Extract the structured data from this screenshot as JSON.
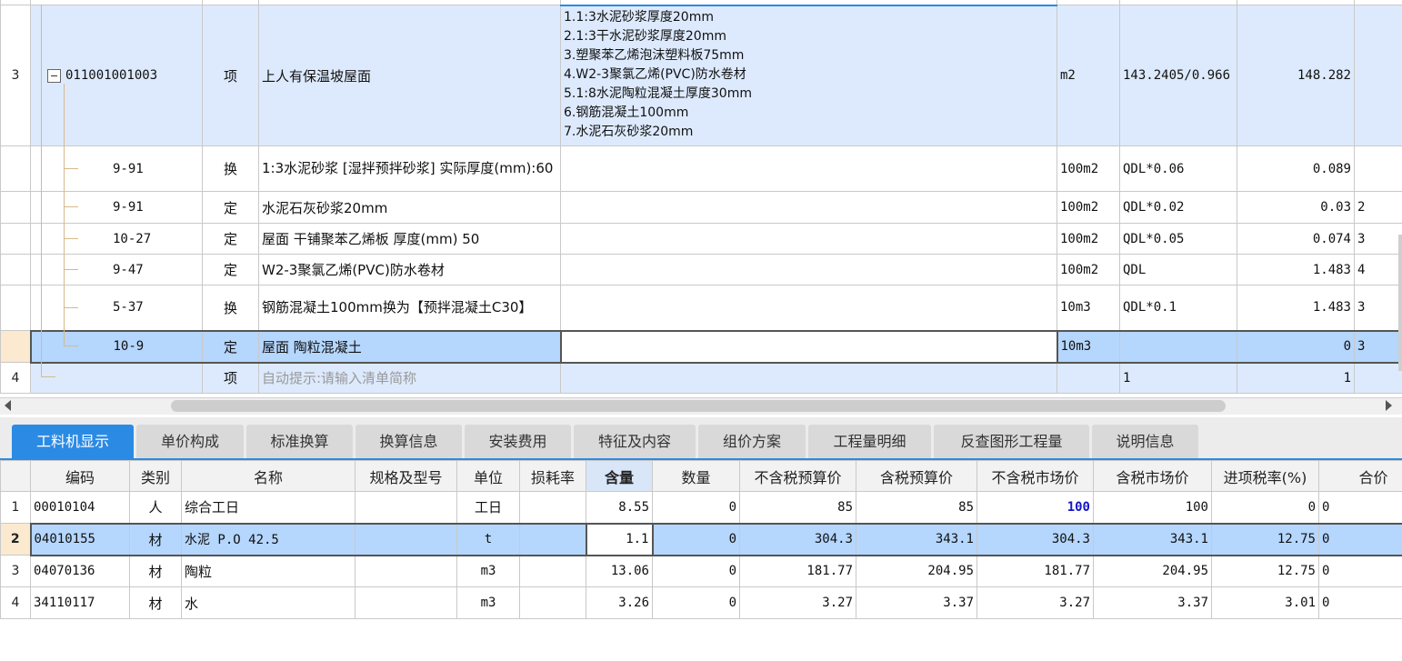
{
  "upper": {
    "rows": [
      {
        "num": "3",
        "code": "011001001003",
        "type": "项",
        "name": "上人有保温坡屋面",
        "desc": [
          "1.1:3水泥砂浆厚度20mm",
          "2.1:3干水泥砂浆厚度20mm",
          "3.塑聚苯乙烯泡沫塑料板75mm",
          "4.W2-3聚氯乙烯(PVC)防水卷材",
          "5.1:8水泥陶粒混凝土厚度30mm",
          "6.钢筋混凝土100mm",
          "7.水泥石灰砂浆20mm"
        ],
        "unit": "m2",
        "expr": "143.2405/0.966",
        "qty": "148.282"
      },
      {
        "num": "",
        "code": "9-91",
        "type": "换",
        "name": "1:3水泥砂浆 [湿拌预拌砂浆] 实际厚度(mm):60",
        "unit": "100m2",
        "expr": "QDL*0.06",
        "qty": "0.089",
        "extra": ""
      },
      {
        "num": "",
        "code": "9-91",
        "type": "定",
        "name": "水泥石灰砂浆20mm",
        "unit": "100m2",
        "expr": "QDL*0.02",
        "qty": "0.03",
        "extra": "2"
      },
      {
        "num": "",
        "code": "10-27",
        "type": "定",
        "name": "屋面 干铺聚苯乙烯板 厚度(mm) 50",
        "unit": "100m2",
        "expr": "QDL*0.05",
        "qty": "0.074",
        "extra": "3"
      },
      {
        "num": "",
        "code": "9-47",
        "type": "定",
        "name": "W2-3聚氯乙烯(PVC)防水卷材",
        "unit": "100m2",
        "expr": "QDL",
        "qty": "1.483",
        "extra": "4"
      },
      {
        "num": "",
        "code": "5-37",
        "type": "换",
        "name": "钢筋混凝土100mm换为【预拌混凝土C30】",
        "unit": "10m3",
        "expr": "QDL*0.1",
        "qty": "1.483",
        "extra": "3"
      },
      {
        "num": "",
        "code": "10-9",
        "type": "定",
        "name": "屋面 陶粒混凝土",
        "unit": "10m3",
        "expr": "",
        "qty": "0",
        "extra": "3"
      },
      {
        "num": "4",
        "code": "",
        "type": "项",
        "name": "自动提示:请输入清单简称",
        "unit": "",
        "expr": "1",
        "qty": "1",
        "extra": ""
      }
    ]
  },
  "tabs": [
    "工料机显示",
    "单价构成",
    "标准换算",
    "换算信息",
    "安装费用",
    "特征及内容",
    "组价方案",
    "工程量明细",
    "反查图形工程量",
    "说明信息"
  ],
  "lower": {
    "headers": [
      "编码",
      "类别",
      "名称",
      "规格及型号",
      "单位",
      "损耗率",
      "含量",
      "数量",
      "不含税预算价",
      "含税预算价",
      "不含税市场价",
      "含税市场价",
      "进项税率(%)",
      "合价"
    ],
    "rows": [
      {
        "num": "1",
        "code": "00010104",
        "cat": "人",
        "name": "综合工日",
        "spec": "",
        "unit": "工日",
        "loss": "",
        "content": "8.55",
        "qty": "0",
        "p1": "85",
        "p2": "85",
        "p3": "100",
        "p4": "100",
        "tax": "0",
        "total": "0"
      },
      {
        "num": "2",
        "code": "04010155",
        "cat": "材",
        "name": "水泥 P.O 42.5",
        "spec": "",
        "unit": "t",
        "loss": "",
        "content": "1.1",
        "qty": "0",
        "p1": "304.3",
        "p2": "343.1",
        "p3": "304.3",
        "p4": "343.1",
        "tax": "12.75",
        "total": "0"
      },
      {
        "num": "3",
        "code": "04070136",
        "cat": "材",
        "name": "陶粒",
        "spec": "",
        "unit": "m3",
        "loss": "",
        "content": "13.06",
        "qty": "0",
        "p1": "181.77",
        "p2": "204.95",
        "p3": "181.77",
        "p4": "204.95",
        "tax": "12.75",
        "total": "0"
      },
      {
        "num": "4",
        "code": "34110117",
        "cat": "材",
        "name": "水",
        "spec": "",
        "unit": "m3",
        "loss": "",
        "content": "3.26",
        "qty": "0",
        "p1": "3.27",
        "p2": "3.37",
        "p3": "3.27",
        "p4": "3.37",
        "tax": "3.01",
        "total": "0"
      }
    ]
  }
}
